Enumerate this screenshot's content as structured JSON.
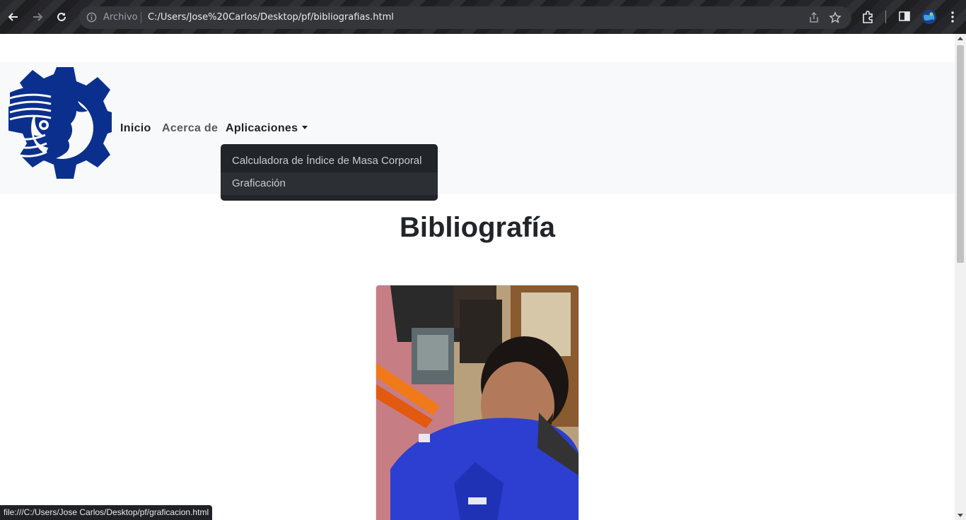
{
  "browser": {
    "omnibox": {
      "scheme_label": "Archivo",
      "url": "C:/Users/Jose%20Carlos/Desktop/pf/bibliografias.html"
    },
    "status_url": "file:///C:/Users/Jose Carlos/Desktop/pf/graficacion.html"
  },
  "navbar": {
    "links": [
      "Inicio",
      "Acerca de",
      "Aplicaciones"
    ],
    "dropdown": {
      "items": [
        "Calculadora de Índice de Masa Corporal",
        "Graficación"
      ],
      "hovered_index": 1
    }
  },
  "main": {
    "heading": "Bibliografía"
  },
  "colors": {
    "logo_blue": "#0b2f8c",
    "navbar_bg": "#f8f9fa",
    "dropdown_bg": "#212529",
    "photo_shirt": "#2c3fd1"
  },
  "icons": [
    "back-arrow-icon",
    "forward-arrow-icon",
    "reload-icon",
    "info-icon",
    "share-icon",
    "star-icon",
    "extensions-icon",
    "side-panel-icon",
    "profile-icon",
    "menu-icon"
  ]
}
